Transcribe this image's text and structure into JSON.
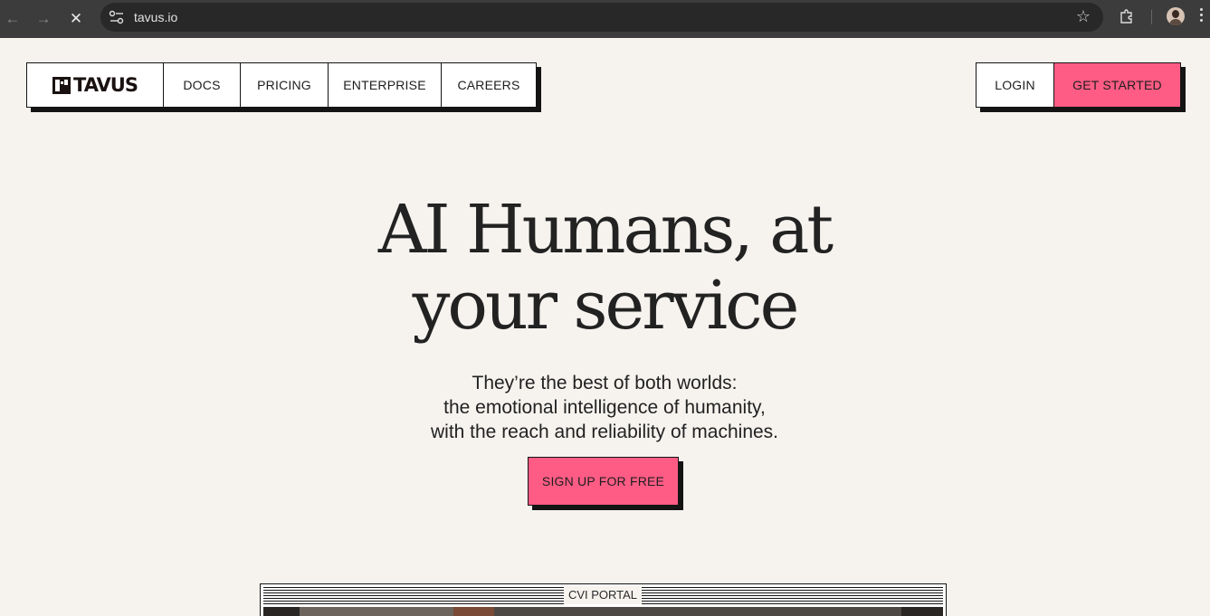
{
  "browser": {
    "url": "tavus.io"
  },
  "nav": {
    "logo_text": "TAVUS",
    "items": [
      {
        "label": "DOCS"
      },
      {
        "label": "PRICING"
      },
      {
        "label": "ENTERPRISE"
      },
      {
        "label": "CAREERS"
      }
    ],
    "login_label": "LOGIN",
    "get_started_label": "GET STARTED"
  },
  "hero": {
    "title_line1": "AI Humans, at",
    "title_line2": "your service",
    "subtitle_line1": "They’re the best of both worlds:",
    "subtitle_line2": "the emotional intelligence of humanity,",
    "subtitle_line3": "with the reach and reliability of machines.",
    "cta_label": "SIGN UP FOR FREE"
  },
  "portal": {
    "label": "CVI PORTAL"
  },
  "colors": {
    "background": "#f6f3ef",
    "accent_pink": "#ff5c85",
    "ink": "#141414"
  }
}
